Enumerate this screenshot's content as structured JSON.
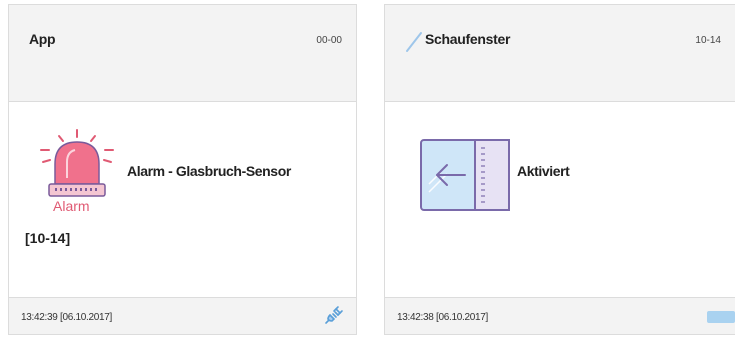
{
  "cards": [
    {
      "title": "App",
      "code": "00-00",
      "icon": "siren-alarm-icon",
      "icon_label": "Alarm",
      "main_text": "Alarm - Glasbruch-Sensor",
      "sub_text": "[10-14]",
      "timestamp": "13:42:39 [06.10.2017]",
      "footer_icon": "plug-icon",
      "accent_color": "#e05a73"
    },
    {
      "title": "Schaufenster",
      "code": "10-14",
      "title_icon": "pencil-icon",
      "icon": "window-arrow-icon",
      "main_text": "Aktiviert",
      "timestamp": "13:42:38 [06.10.2017]",
      "footer_icon": "status-indicator-icon",
      "accent_color": "#8a7cc0"
    }
  ]
}
